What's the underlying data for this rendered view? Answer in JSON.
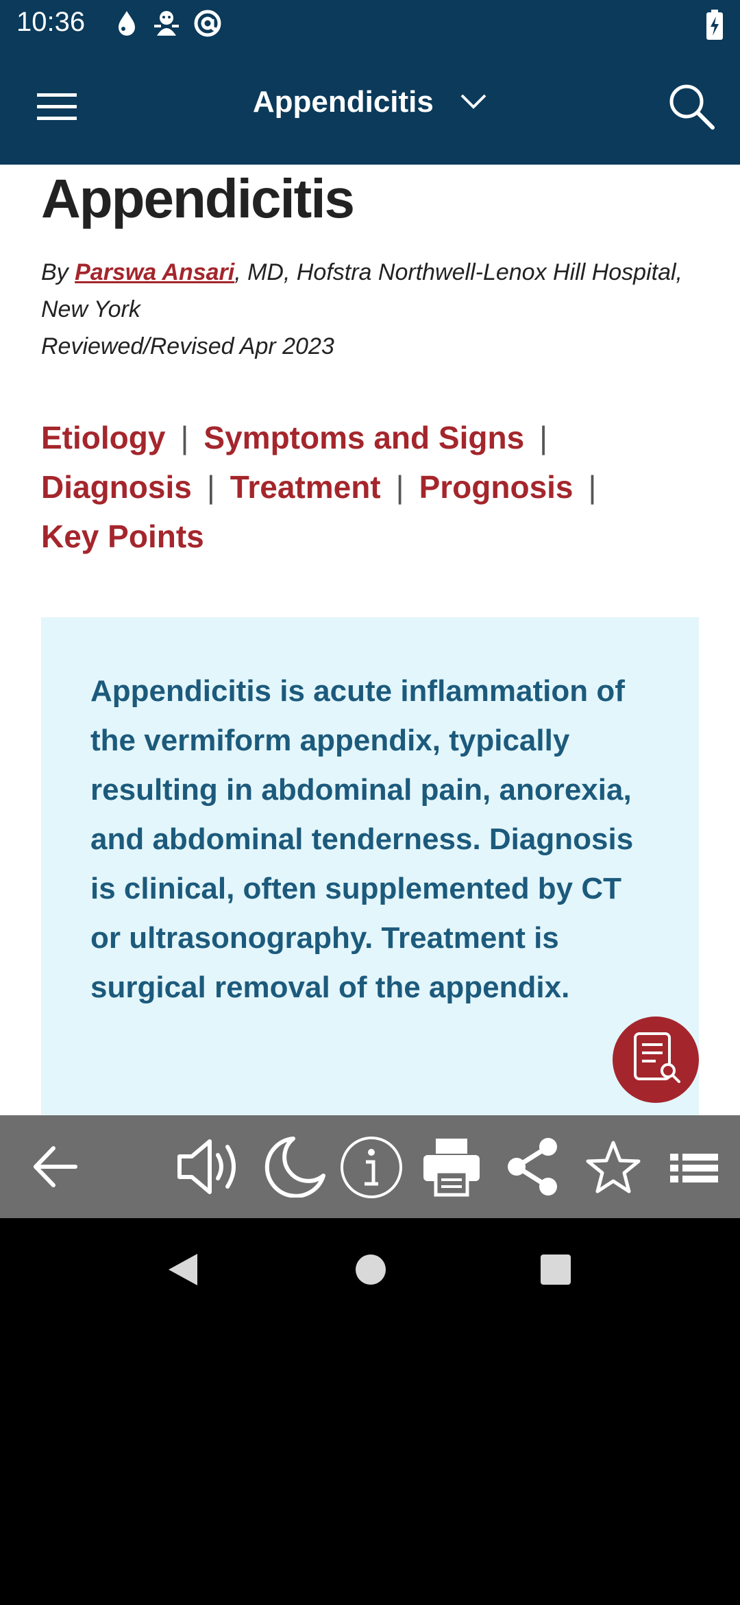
{
  "status_bar": {
    "time": "10:36",
    "icons": [
      "water-drop-icon",
      "mascot-icon",
      "at-sign-icon",
      "battery-charging-icon"
    ]
  },
  "app_bar": {
    "title": "Appendicitis",
    "icons": [
      "hamburger-menu-icon",
      "chevron-down-icon",
      "search-icon"
    ]
  },
  "article": {
    "title": "Appendicitis",
    "byline_prefix": "By ",
    "author": "Parswa Ansari",
    "byline_suffix": ", MD, Hofstra Northwell-Lenox Hill Hospital, New York",
    "reviewed": "Reviewed/Revised Apr 2023",
    "section_links": {
      "etiology": "Etiology",
      "symptoms": "Symptoms and Signs",
      "diagnosis": "Diagnosis",
      "treatment": "Treatment",
      "prognosis": "Prognosis",
      "key_points": "Key Points"
    },
    "separator": "|",
    "summary": "Appendicitis is acute inflammation of the vermiform appendix, typically resulting in abdominal pain, anorexia, and abdominal tenderness. Diagnosis is clinical, often supplemented by CT or ultrasonography. Treatment is surgical removal of the appendix."
  },
  "fab": {
    "icon": "document-search-icon"
  },
  "toolbar": {
    "icons": [
      "back-arrow-icon",
      "speaker-icon",
      "night-mode-icon",
      "info-icon",
      "print-icon",
      "share-icon",
      "favorite-star-icon",
      "list-icon"
    ]
  },
  "nav_bar": {
    "icons": [
      "nav-back-icon",
      "nav-home-icon",
      "nav-recents-icon"
    ]
  },
  "colors": {
    "header": "#0b3a5a",
    "link": "#a4262c",
    "summary_bg": "#e3f6fb",
    "summary_text": "#1c5a7c",
    "toolbar": "#6e6e6e"
  }
}
